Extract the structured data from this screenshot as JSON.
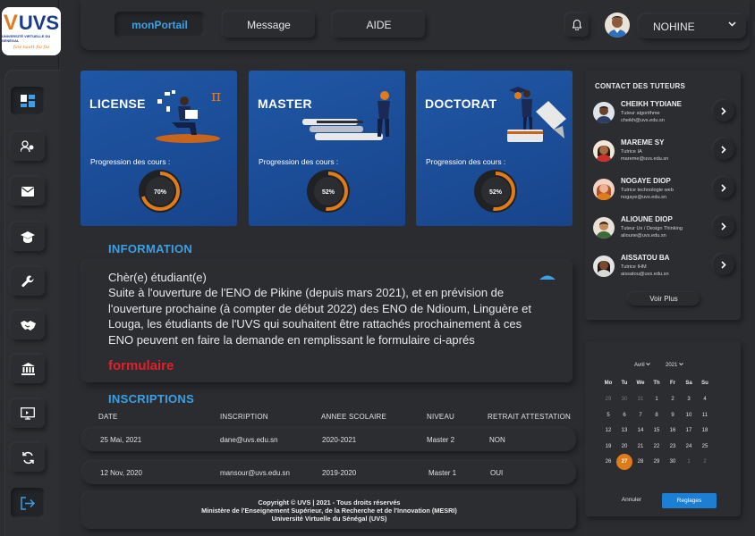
{
  "logo": {
    "text": "UVS",
    "subtitle": "UNIVERSITÉ VIRTUELLE DU SÉNÉGAL",
    "tagline": "faw naatt fiu fiu"
  },
  "nav": {
    "portal": "monPortail",
    "message": "Message",
    "help": "AIDE"
  },
  "user": {
    "name": "NOHINE"
  },
  "cards": [
    {
      "title": "LICENSE",
      "progress_label": "Progression des cours :",
      "progress": 0.7,
      "progress_text": "70%"
    },
    {
      "title": "MASTER",
      "progress_label": "Progression des cours :",
      "progress": 0.52,
      "progress_text": "52%"
    },
    {
      "title": "DOCTORAT",
      "progress_label": "Progression des cours :",
      "progress": 0.52,
      "progress_text": "52%"
    }
  ],
  "information": {
    "title": "INFORMATION",
    "greeting": "Chèr(e) étudiant(e)",
    "body": "Suite à l'ouverture de l'ENO de Pikine (depuis mars 2021), et en prévision de l'ouverture prochaine (à compter de début 2022) des ENO de Ndioum, Linguère et Louga, les étudiants de l'UVS qui souhaitent être rattachés prochainement à ces ENO peuvent en faire la demande en remplissant le formulaire ci-aprés",
    "link": "formulaire"
  },
  "inscriptions": {
    "title": "INSCRIPTIONS",
    "headers": [
      "DATE",
      "INSCRIPTION",
      "ANNEE SCOLAIRE",
      "NIVEAU",
      "RETRAIT ATTESTATION"
    ],
    "rows": [
      [
        "25 Mai, 2021",
        "dane@uvs.edu.sn",
        "2020-2021",
        "Master 2",
        "NON"
      ],
      [
        "12 Nov, 2020",
        "mansour@uvs.edu.sn",
        "2019-2020",
        "Master 1",
        "OUI"
      ]
    ]
  },
  "footer": {
    "line1": "Copyright © UVS | 2021 - Tous droits réservés",
    "line2": "Ministère de l'Enseignement Supérieur, de la Recherche et de l'Innovation (MESRI)",
    "line3": "Université Virtuelle du Sénégal (UVS)"
  },
  "tutors": {
    "title": "CONTACT DES TUTEURS",
    "items": [
      {
        "name": "CHEIKH TYDIANE",
        "role": "Tuteur algorithme",
        "email": "cheikh@uvs.edu.sn"
      },
      {
        "name": "MAREME SY",
        "role": "Tutrice IA",
        "email": "mareme@uvs.edu.sn"
      },
      {
        "name": "NOGAYE DIOP",
        "role": "Tutrice  technologie web",
        "email": "nogaye@uvs.edu.sn"
      },
      {
        "name": "ALIOUNE DIOP",
        "role": "Tuteur Ux / Design Thinking",
        "email": "alioune@uvs.edu.sn"
      },
      {
        "name": "AISSATOU BA",
        "role": "Tutrice IHM",
        "email": "aissatou@uvs.edu.sn"
      }
    ],
    "more": "Voir Plus"
  },
  "calendar": {
    "month": "Avril",
    "year": "2021",
    "weekdays": [
      "Mo",
      "Tu",
      "We",
      "Th",
      "Fr",
      "Sa",
      "Su"
    ],
    "weeks": [
      [
        "29",
        "30",
        "31",
        "1",
        "2",
        "3",
        "4"
      ],
      [
        "5",
        "6",
        "7",
        "8",
        "9",
        "10",
        "11"
      ],
      [
        "12",
        "13",
        "14",
        "15",
        "16",
        "17",
        "18"
      ],
      [
        "19",
        "20",
        "21",
        "22",
        "23",
        "24",
        "25"
      ],
      [
        "26",
        "27",
        "28",
        "29",
        "30",
        "1",
        "2"
      ]
    ],
    "today": "27",
    "cancel": "Annuler",
    "confirm": "Reglages"
  },
  "colors": {
    "accent": "#3d9fe4",
    "orange": "#e07b1a",
    "red": "#e21f2a",
    "card_blue": "#1f57a6",
    "bg": "#2a2c30"
  }
}
